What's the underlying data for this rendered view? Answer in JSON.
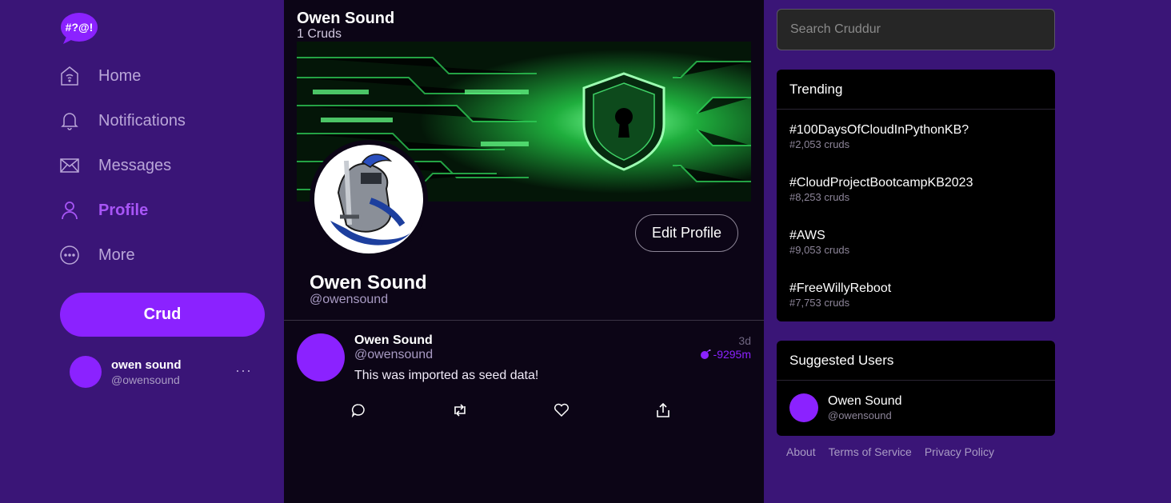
{
  "app": {
    "logo_text": "#?@!",
    "brand_color": "#8b22ff"
  },
  "nav": {
    "items": [
      {
        "label": "Home",
        "icon": "home-icon"
      },
      {
        "label": "Notifications",
        "icon": "bell-icon"
      },
      {
        "label": "Messages",
        "icon": "mail-icon"
      },
      {
        "label": "Profile",
        "icon": "user-icon",
        "active": true
      },
      {
        "label": "More",
        "icon": "more-circle-icon"
      }
    ],
    "crud_button": "Crud",
    "current_user": {
      "name": "owen sound",
      "handle": "@owensound",
      "menu": "···"
    }
  },
  "profile": {
    "header_name": "Owen Sound",
    "crud_count": "1 Cruds",
    "display_name": "Owen Sound",
    "handle": "@owensound",
    "edit_button": "Edit Profile"
  },
  "feed": [
    {
      "name": "Owen Sound",
      "handle": "@owensound",
      "time": "3d",
      "expires": "-9295m",
      "text": "This was imported as seed data!"
    }
  ],
  "search": {
    "placeholder": "Search Cruddur"
  },
  "trending": {
    "title": "Trending",
    "items": [
      {
        "tag": "#100DaysOfCloudInPythonKB?",
        "count": "#2,053 cruds"
      },
      {
        "tag": "#CloudProjectBootcampKB2023",
        "count": "#8,253 cruds"
      },
      {
        "tag": "#AWS",
        "count": "#9,053 cruds"
      },
      {
        "tag": "#FreeWillyReboot",
        "count": "#7,753 cruds"
      }
    ]
  },
  "suggested": {
    "title": "Suggested Users",
    "users": [
      {
        "name": "Owen Sound",
        "handle": "@owensound"
      }
    ]
  },
  "footer": {
    "links": [
      "About",
      "Terms of Service",
      "Privacy Policy"
    ]
  }
}
